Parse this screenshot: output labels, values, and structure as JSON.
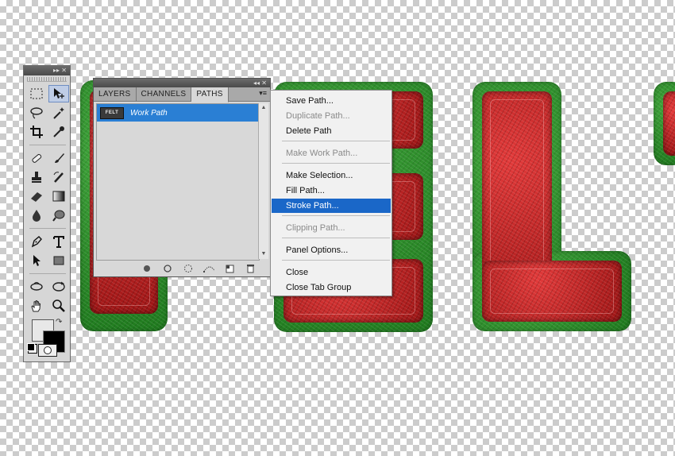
{
  "panel": {
    "tabs": [
      {
        "label": "LAYERS"
      },
      {
        "label": "CHANNELS"
      },
      {
        "label": "PATHS"
      }
    ],
    "path": {
      "thumb_text": "FELT",
      "name": "Work Path"
    }
  },
  "menu": {
    "items": [
      {
        "label": "Save Path...",
        "disabled": false,
        "selected": false
      },
      {
        "label": "Duplicate Path...",
        "disabled": true,
        "selected": false
      },
      {
        "label": "Delete Path",
        "disabled": false,
        "selected": false
      },
      {
        "label": "Make Work Path...",
        "disabled": true,
        "selected": false
      },
      {
        "label": "Make Selection...",
        "disabled": false,
        "selected": false
      },
      {
        "label": "Fill Path...",
        "disabled": false,
        "selected": false
      },
      {
        "label": "Stroke Path...",
        "disabled": false,
        "selected": true
      },
      {
        "label": "Clipping Path...",
        "disabled": true,
        "selected": false
      },
      {
        "label": "Panel Options...",
        "disabled": false,
        "selected": false
      },
      {
        "label": "Close",
        "disabled": false,
        "selected": false
      },
      {
        "label": "Close Tab Group",
        "disabled": false,
        "selected": false
      }
    ]
  },
  "colors": {
    "selection": "#1a67c8",
    "path_row": "#2a7fd4",
    "felt_red": "#c42020",
    "felt_green": "#2e8b2a"
  },
  "tools": [
    "marquee-icon",
    "move-icon",
    "lasso-icon",
    "magic-wand-icon",
    "crop-icon",
    "eyedropper-icon",
    "healing-brush-icon",
    "brush-icon",
    "clone-stamp-icon",
    "history-brush-icon",
    "eraser-icon",
    "gradient-icon",
    "blur-icon",
    "dodge-icon",
    "pen-icon",
    "type-icon",
    "path-selection-icon",
    "rectangle-icon",
    "3d-rotate-icon",
    "3d-orbit-icon",
    "hand-icon",
    "zoom-icon"
  ]
}
